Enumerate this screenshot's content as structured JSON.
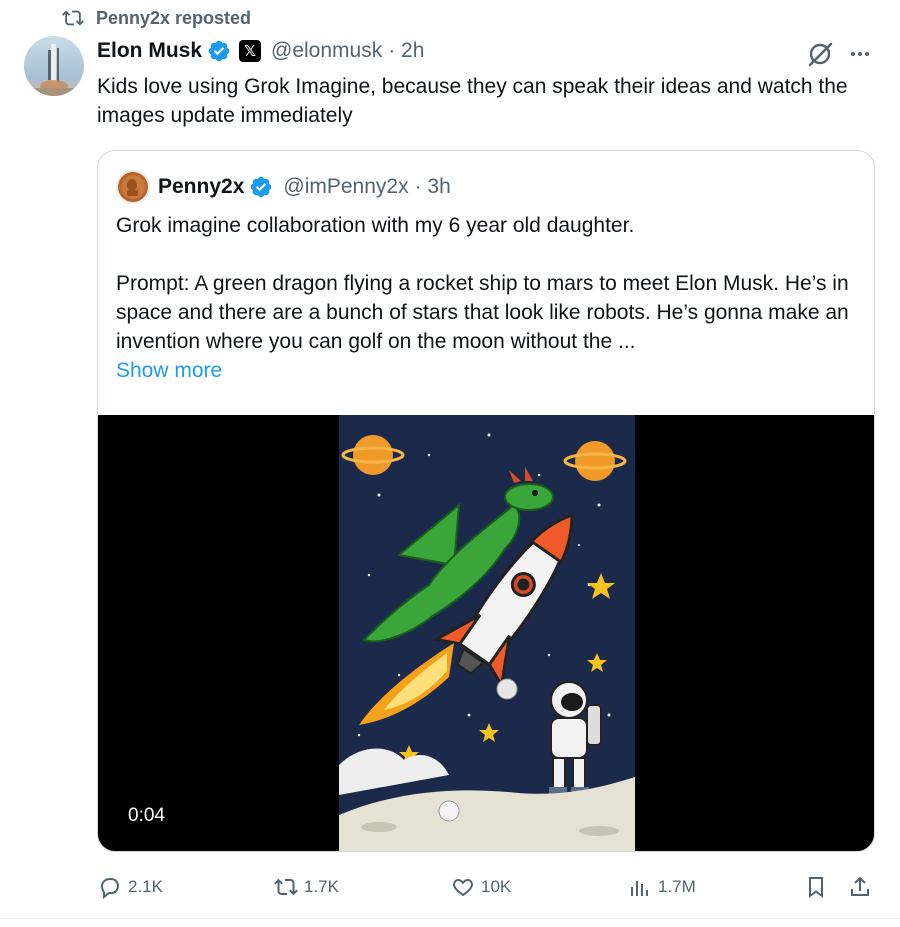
{
  "repost": {
    "icon": "repost-icon",
    "text": "Penny2x reposted"
  },
  "post": {
    "author_name": "Elon Musk",
    "x_badge": "𝕏",
    "handle": "@elonmusk",
    "time": "· 2h",
    "text": "Kids love using Grok Imagine, because they can speak their ideas and watch the images update immediately"
  },
  "quote": {
    "author_name": "Penny2x",
    "handle": "@imPenny2x",
    "time": "· 3h",
    "line1": "Grok imagine collaboration with my 6 year old daughter.",
    "prompt": "Prompt: A green dragon flying a rocket ship to mars to meet Elon Musk. He’s in space and there are a bunch of stars that look like robots. He’s gonna make an invention where you can golf on the moon without the ...",
    "show_more": "Show more",
    "video_duration": "0:04"
  },
  "actions": {
    "replies": "2.1K",
    "reposts": "1.7K",
    "likes": "10K",
    "views": "1.7M"
  },
  "colors": {
    "accent": "#1d9bf0",
    "secondary_text": "#536471",
    "border": "#cfd9de"
  }
}
